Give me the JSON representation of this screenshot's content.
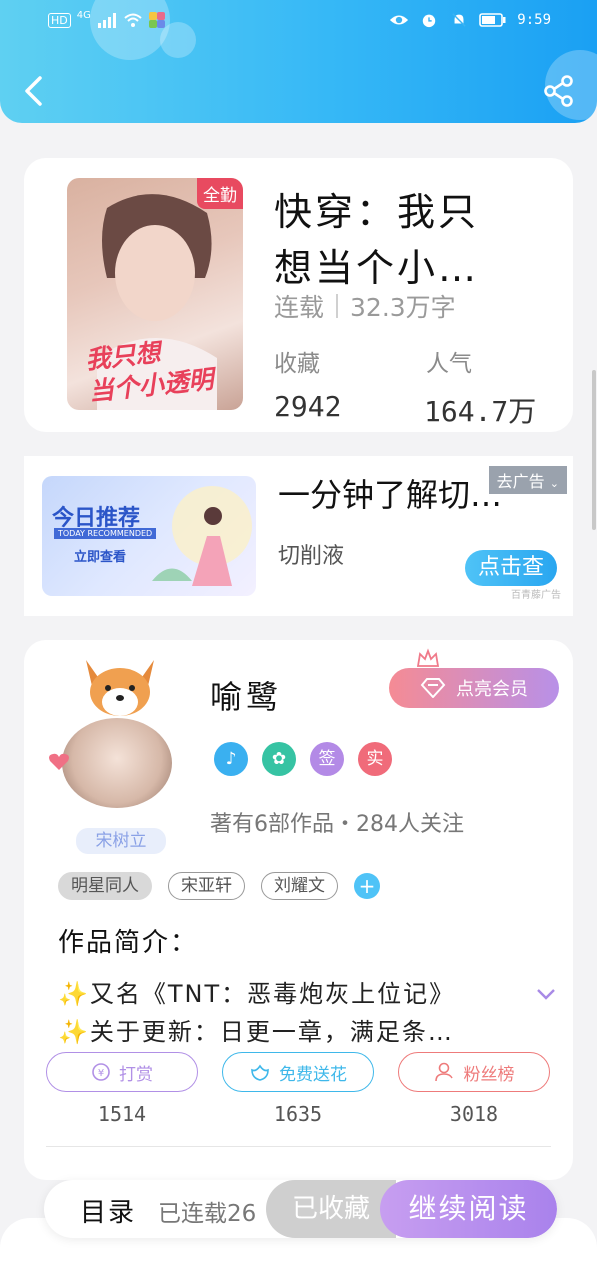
{
  "status_bar": {
    "time": "9:59",
    "signal_label": "HD",
    "network": "4G"
  },
  "book": {
    "cover_badge": "全勤",
    "cover_title_line1": "我只想",
    "cover_title_line2": "当个小透明",
    "title_line1": "快穿：我只",
    "title_line2": "想当个小…",
    "status": "连载",
    "word_count": "32.3万字",
    "favorites_label": "收藏",
    "favorites_value": "2942",
    "popularity_label": "人气",
    "popularity_value": "164.7万"
  },
  "ad": {
    "image_title": "今日推荐",
    "image_subtitle": "TODAY RECOMMENDED",
    "image_button": "立即查看",
    "title": "一分钟了解切…",
    "tag": "去广告",
    "description": "切削液",
    "button": "点击查",
    "source": "百青藤广告"
  },
  "author": {
    "avatar_name": "宋树立",
    "name": "喻鹭",
    "vip_button": "点亮会员",
    "badges": [
      {
        "label": "♪",
        "color": "#3ab0f0"
      },
      {
        "label": "✿",
        "color": "#36c3a3"
      },
      {
        "label": "签",
        "color": "#b38ae6"
      },
      {
        "label": "实",
        "color": "#f06b7a"
      }
    ],
    "meta": "著有6部作品・284人关注",
    "tags": [
      "明星同人",
      "宋亚轩",
      "刘耀文"
    ],
    "intro_label": "作品简介：",
    "intro_line1": "✨又名《TNT：恶毒炮灰上位记》",
    "intro_line2": "✨关于更新：日更一章，满足条…",
    "actions": [
      {
        "label": "打赏",
        "count": "1514",
        "color": "#b190e6"
      },
      {
        "label": "免费送花",
        "count": "1635",
        "color": "#3fb8ea"
      },
      {
        "label": "粉丝榜",
        "count": "3018",
        "color": "#ee7b7b"
      }
    ]
  },
  "bottom_bar": {
    "toc_label": "目录",
    "toc_status": "已连载26",
    "collected_button": "已收藏",
    "continue_button": "继续阅读"
  }
}
